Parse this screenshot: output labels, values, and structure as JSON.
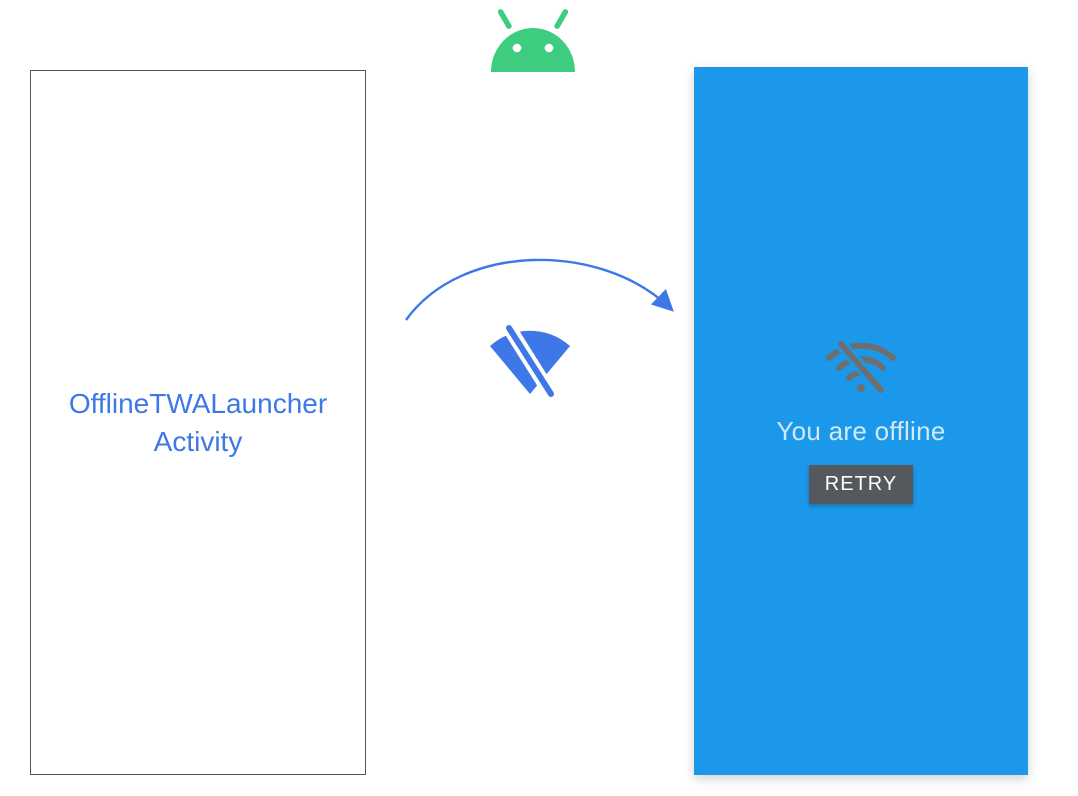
{
  "colors": {
    "blue_text": "#3e78e6",
    "blue_screen": "#1c98ea",
    "android_green": "#3ecc80",
    "arrow_blue": "#3e78e6",
    "btn_bg": "#54595d",
    "grey_icon": "#6e6e6e"
  },
  "left": {
    "label_line1": "OfflineTWALauncher",
    "label_line2": "Activity"
  },
  "center": {
    "icon_name": "wifi-off"
  },
  "right": {
    "message": "You are offline",
    "button_label": "RETRY",
    "icon_name": "wifi-off"
  }
}
